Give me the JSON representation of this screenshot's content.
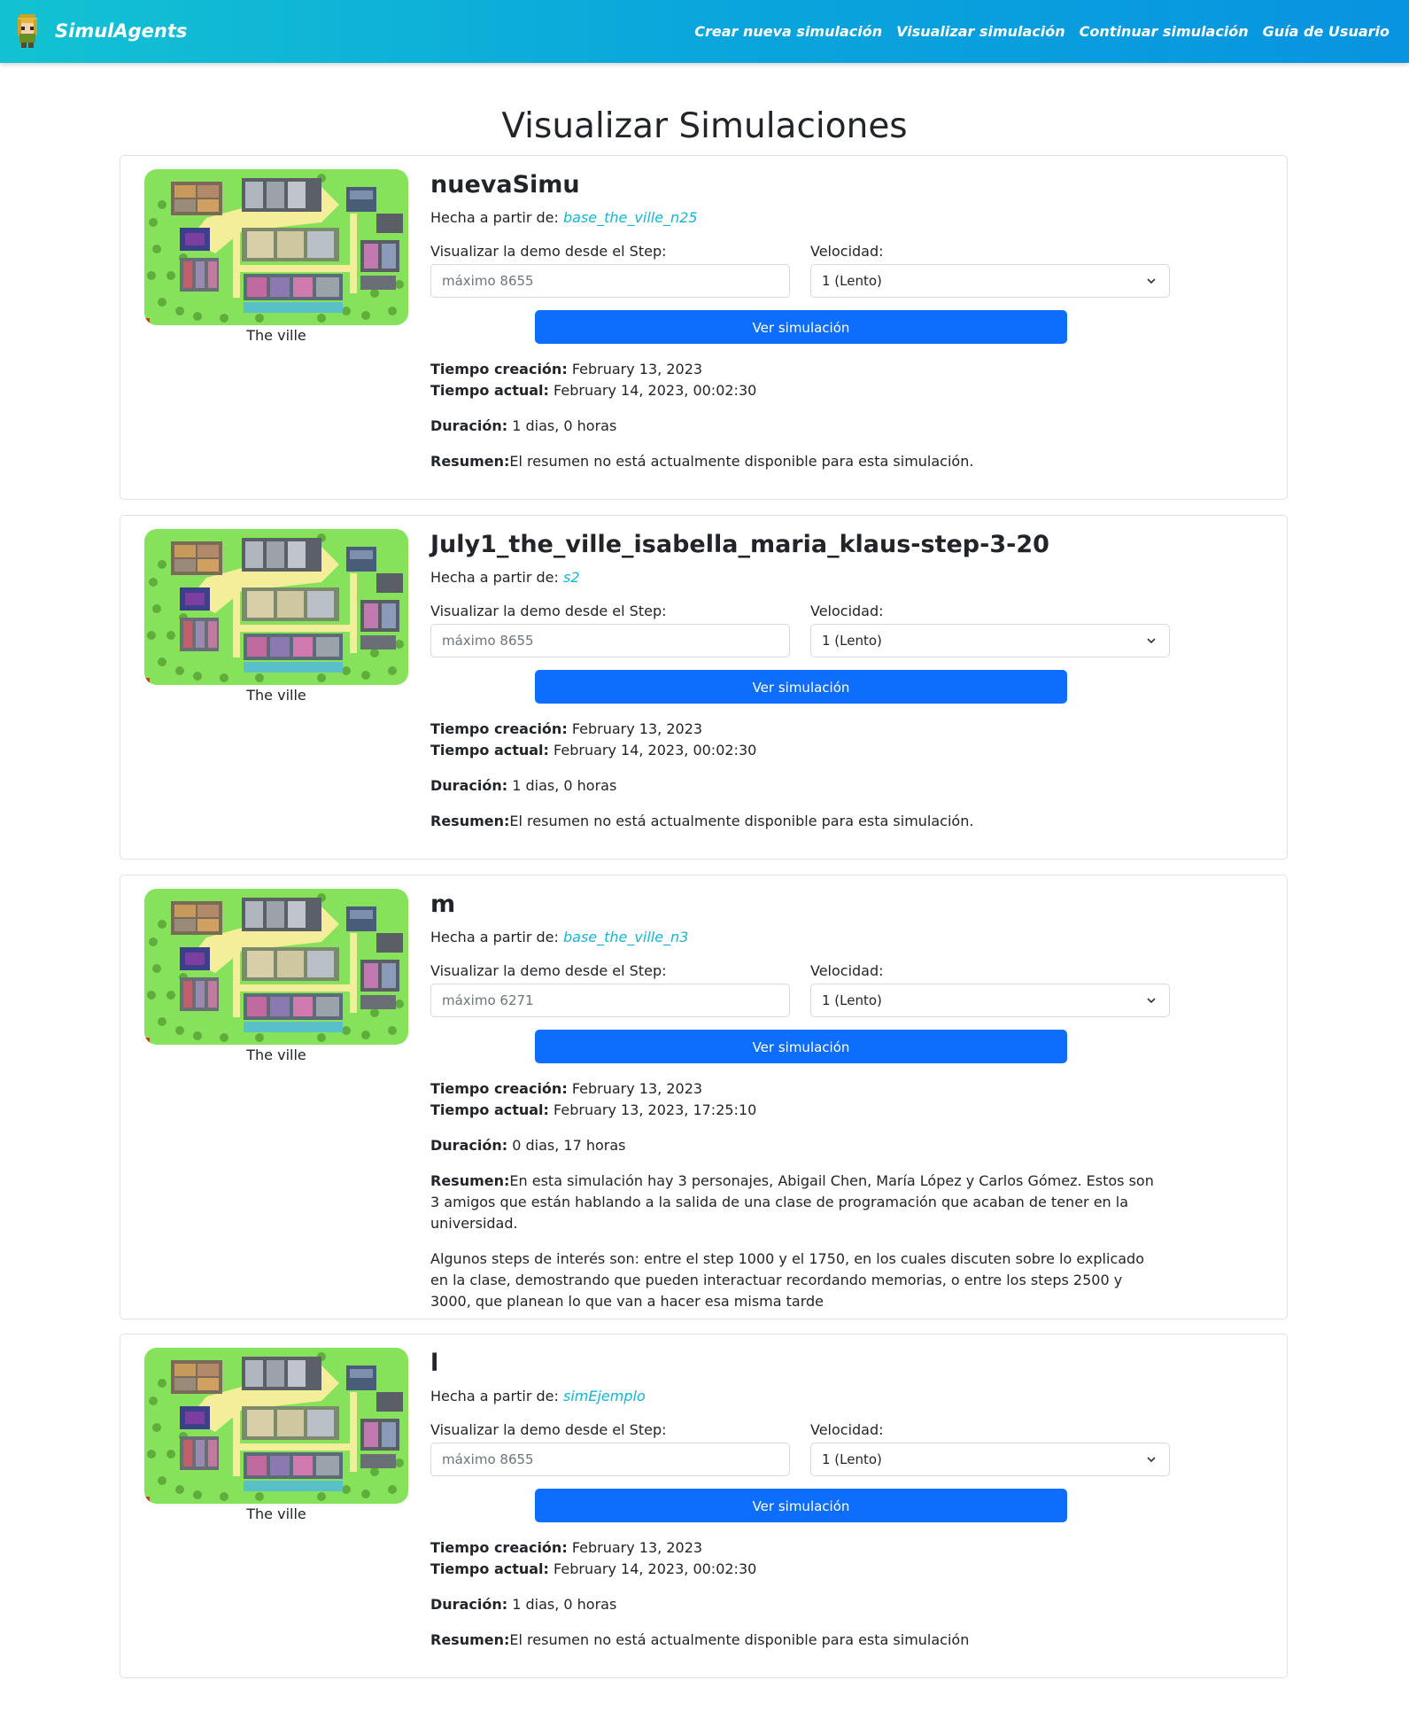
{
  "navbar": {
    "brand": "SimulAgents",
    "links": [
      "Crear nueva simulación",
      "Visualizar simulación",
      "Continuar simulación",
      "Guía de Usuario"
    ]
  },
  "page": {
    "title": "Visualizar Simulaciones"
  },
  "labels": {
    "origin": "Hecha a partir de:",
    "step": "Visualizar la demo desde el Step:",
    "speed": "Velocidad:",
    "view_button": "Ver simulación",
    "created": "Tiempo creación:",
    "current": "Tiempo actual:",
    "duration": "Duración:",
    "summary": "Resumen:",
    "map": "The ville"
  },
  "simulations": [
    {
      "name": "nuevaSimu",
      "origin": "base_the_ville_n25",
      "step_placeholder": "máximo 8655",
      "speed": "1 (Lento)",
      "created": "February 13, 2023",
      "current": "February 14, 2023, 00:02:30",
      "duration": "1 dias, 0 horas",
      "summary": "El resumen no está actualmente disponible para esta simulación.",
      "summary_extra": ""
    },
    {
      "name": "July1_the_ville_isabella_maria_klaus-step-3-20",
      "origin": "s2",
      "step_placeholder": "máximo 8655",
      "speed": "1 (Lento)",
      "created": "February 13, 2023",
      "current": "February 14, 2023, 00:02:30",
      "duration": "1 dias, 0 horas",
      "summary": "El resumen no está actualmente disponible para esta simulación.",
      "summary_extra": ""
    },
    {
      "name": "m",
      "origin": "base_the_ville_n3",
      "step_placeholder": "máximo 6271",
      "speed": "1 (Lento)",
      "created": "February 13, 2023",
      "current": "February 13, 2023, 17:25:10",
      "duration": "0 dias, 17 horas",
      "summary": "En esta simulación hay 3 personajes, Abigail Chen, María López y Carlos Gómez. Estos son 3 amigos que están hablando a la salida de una clase de programación que acaban de tener en la universidad.",
      "summary_extra": "Algunos steps de interés son: entre el step 1000 y el 1750, en los cuales discuten sobre lo explicado en la clase, demostrando que pueden interactuar recordando memorias, o entre los steps 2500 y 3000, que planean lo que van a hacer esa misma tarde"
    },
    {
      "name": "l",
      "origin": "simEjemplo",
      "step_placeholder": "máximo 8655",
      "speed": "1 (Lento)",
      "created": "February 13, 2023",
      "current": "February 14, 2023, 00:02:30",
      "duration": "1 dias, 0 horas",
      "summary": "El resumen no está actualmente disponible para esta simulación",
      "summary_extra": ""
    }
  ],
  "colors": {
    "primary": "#0d6efd",
    "link": "#16b4cf",
    "nav_start": "#13c2d2",
    "nav_end": "#0894e0"
  }
}
